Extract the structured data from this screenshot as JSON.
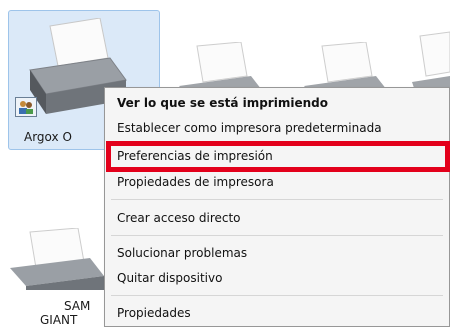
{
  "devices": [
    {
      "label": "Argox O",
      "selected": true
    },
    {
      "label": "",
      "selected": false
    },
    {
      "label": "",
      "selected": false
    },
    {
      "label": "",
      "selected": false
    },
    {
      "label_line1": "SAM",
      "label_line2": "GIANT"
    }
  ],
  "context_menu": {
    "items": [
      {
        "label": "Ver lo que se está imprimiendo",
        "bold": true
      },
      {
        "label": "Establecer como impresora predeterminada"
      },
      {
        "label": "Preferencias de impresión",
        "highlighted": true
      },
      {
        "label": "Propiedades de impresora"
      },
      {
        "label": "Crear acceso directo"
      },
      {
        "label": "Solucionar problemas"
      },
      {
        "label": "Quitar dispositivo"
      },
      {
        "label": "Propiedades"
      }
    ]
  },
  "colors": {
    "highlight_border": "#e3001b",
    "selection_fill": "#dbe9f8",
    "menu_bg": "#f5f5f5"
  },
  "icons": [
    "printer-icon",
    "user-badge-icon"
  ]
}
